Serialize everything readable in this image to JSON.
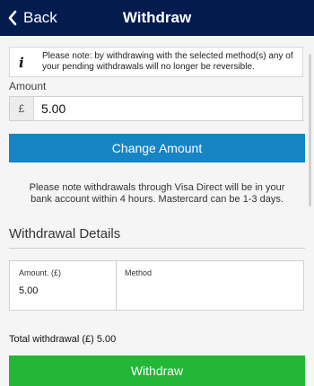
{
  "header": {
    "back_label": "Back",
    "title": "Withdraw"
  },
  "notice": {
    "icon": "info-icon",
    "icon_glyph": "i",
    "text": "Please note: by withdrawing with the selected method(s) any of your pending withdrawals will no longer be reversible."
  },
  "amount": {
    "label": "Amount",
    "currency_symbol": "£",
    "value": "5.00"
  },
  "change_button": {
    "label": "Change Amount"
  },
  "visa_note": "Please note withdrawals through Visa Direct will be in your bank account within 4 hours. Mastercard can be 1-3 days.",
  "withdrawal_details": {
    "title": "Withdrawal Details",
    "amount_header": "Amount. (£)",
    "amount_value": "5.00",
    "method_header": "Method"
  },
  "total": "Total withdrawal (£) 5.00",
  "withdraw_button": {
    "label": "Withdraw"
  },
  "colors": {
    "header_bg": "#041b4f",
    "primary_blue": "#1784c6",
    "withdraw_green": "#22b736"
  }
}
